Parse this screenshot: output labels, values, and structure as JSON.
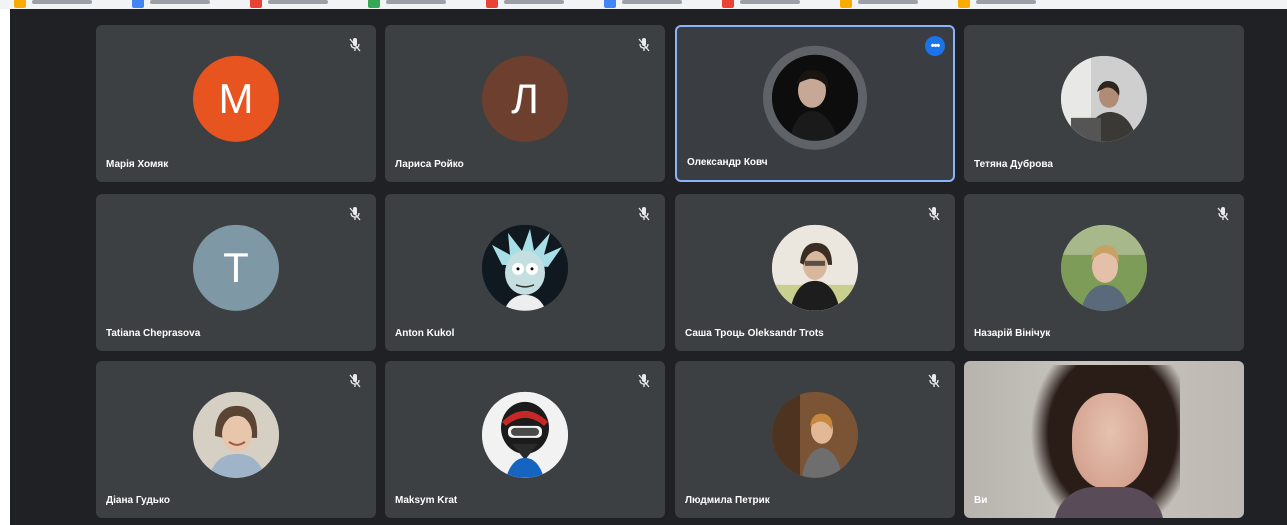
{
  "colors": {
    "background": "#202124",
    "tile": "#3c4043",
    "active_border": "#8ab4f8",
    "more_button": "#1a73e8"
  },
  "participants": [
    {
      "name": "Марія Хомяк",
      "initial": "М",
      "avatar_color": "#e8541f",
      "avatar_type": "initial"
    },
    {
      "name": "Лариса Ройко",
      "initial": "Л",
      "avatar_color": "#6d3f2f",
      "avatar_type": "initial"
    },
    {
      "name": "Олександр Ковч",
      "avatar_type": "photo",
      "active": true
    },
    {
      "name": "Тетяна Дуброва",
      "avatar_type": "photo"
    },
    {
      "name": "Tatiana Cheprasova",
      "initial": "T",
      "avatar_color": "#7f98a6",
      "avatar_type": "initial"
    },
    {
      "name": "Anton Kukol",
      "avatar_type": "photo"
    },
    {
      "name": "Саша Троць Oleksandr Trots",
      "avatar_type": "photo"
    },
    {
      "name": "Назарій Вінічук",
      "avatar_type": "photo"
    },
    {
      "name": "Діана Гудько",
      "avatar_type": "photo"
    },
    {
      "name": "Maksym Krat",
      "avatar_type": "photo"
    },
    {
      "name": "Людмила Петрик",
      "avatar_type": "photo"
    },
    {
      "name": "Ви",
      "avatar_type": "video"
    }
  ],
  "icons": {
    "muted": "mic-off-icon",
    "more": "more-options-icon"
  },
  "more_options_label": "•••"
}
